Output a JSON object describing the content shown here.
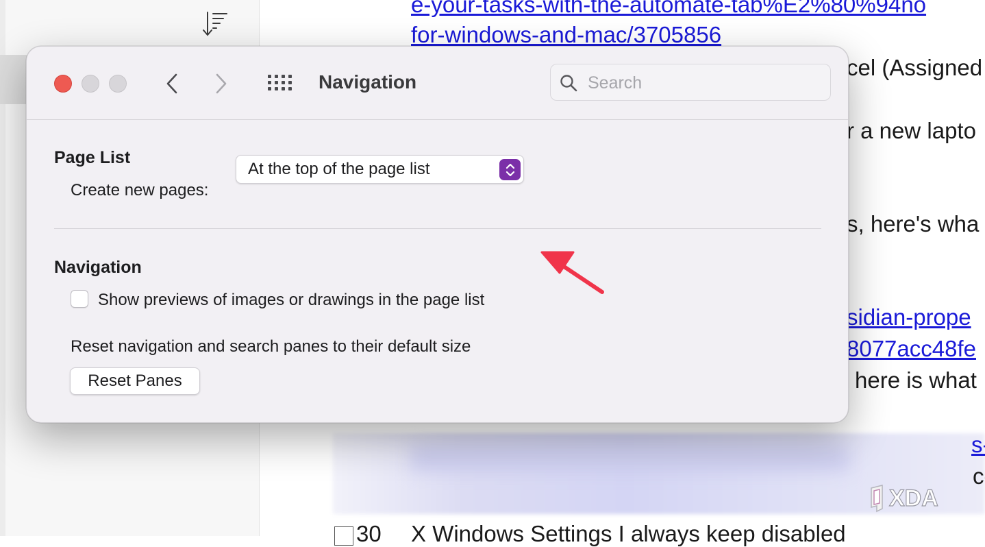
{
  "background_document": {
    "lines": [
      {
        "text": "e-your-tasks-with-the-automate-tab%E2%80%94no",
        "link": true
      },
      {
        "text": "for-windows-and-mac/3705856",
        "link": true
      },
      {
        "text": "cel (Assigned",
        "link": false
      },
      {
        "text": "r a new lapto",
        "link": false
      },
      {
        "text": "s, here's wha",
        "link": false
      },
      {
        "text": "sidian-prope",
        "link": true
      },
      {
        "text": "8077acc48fe",
        "link": true
      },
      {
        "text": "here is what",
        "link": false
      },
      {
        "text": "s-",
        "link": true
      },
      {
        "text": "co",
        "link": false
      },
      {
        "text": "30",
        "link": false
      },
      {
        "text": "X Windows Settings I always keep disabled",
        "link": false
      }
    ],
    "watermark": "XDA"
  },
  "dialog": {
    "title": "Navigation",
    "search": {
      "placeholder": "Search",
      "value": ""
    },
    "page_list": {
      "heading": "Page List",
      "create_label": "Create new pages:",
      "create_value": "At the top of the page list"
    },
    "navigation": {
      "heading": "Navigation",
      "show_previews_label": "Show previews of images or drawings in the page list",
      "show_previews_checked": false,
      "reset_text": "Reset navigation and search panes to their default size",
      "reset_button": "Reset Panes"
    }
  },
  "colors": {
    "accent": "#7b2fa8",
    "close_light": "#ee5a52",
    "annotation_arrow": "#f0344a",
    "link": "#1a1ad8"
  },
  "icons": [
    "sort-icon",
    "back-icon",
    "forward-icon",
    "grid-icon",
    "search-icon",
    "chevron-updown-icon",
    "annotation-arrow-icon"
  ]
}
